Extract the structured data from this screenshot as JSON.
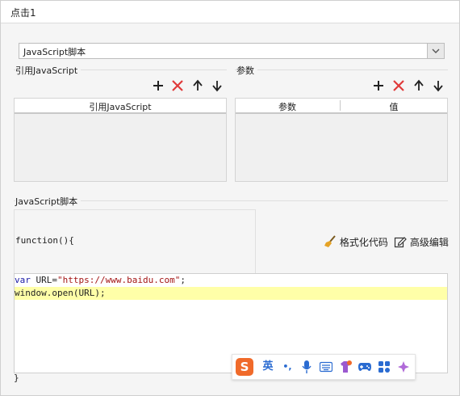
{
  "title": "点击1",
  "event_type": {
    "selected": "JavaScript脚本"
  },
  "ref_section": {
    "label": "引用JavaScript",
    "column": "引用JavaScript",
    "tools": [
      "add-icon",
      "delete-icon",
      "move-up-icon",
      "move-down-icon"
    ]
  },
  "params_section": {
    "label": "参数",
    "columns": [
      "参数",
      "值"
    ],
    "tools": [
      "add-icon",
      "delete-icon",
      "move-up-icon",
      "move-down-icon"
    ]
  },
  "script_section": {
    "label": "JavaScript脚本",
    "function_header": "function(){",
    "format_label": "格式化代码",
    "advanced_label": "高级编辑",
    "code": {
      "line1": {
        "kw": "var",
        "plain1": " URL=",
        "str": "\"https://www.baidu.com\"",
        "plain2": ";"
      },
      "line2": "window.open(URL);"
    },
    "function_footer": "}"
  },
  "ime": {
    "logo": "S",
    "lang": "英",
    "punct": "•,"
  },
  "colors": {
    "accent_red": "#e03a3a",
    "highlight": "#ffffa8",
    "ime_orange": "#f06a2a"
  }
}
